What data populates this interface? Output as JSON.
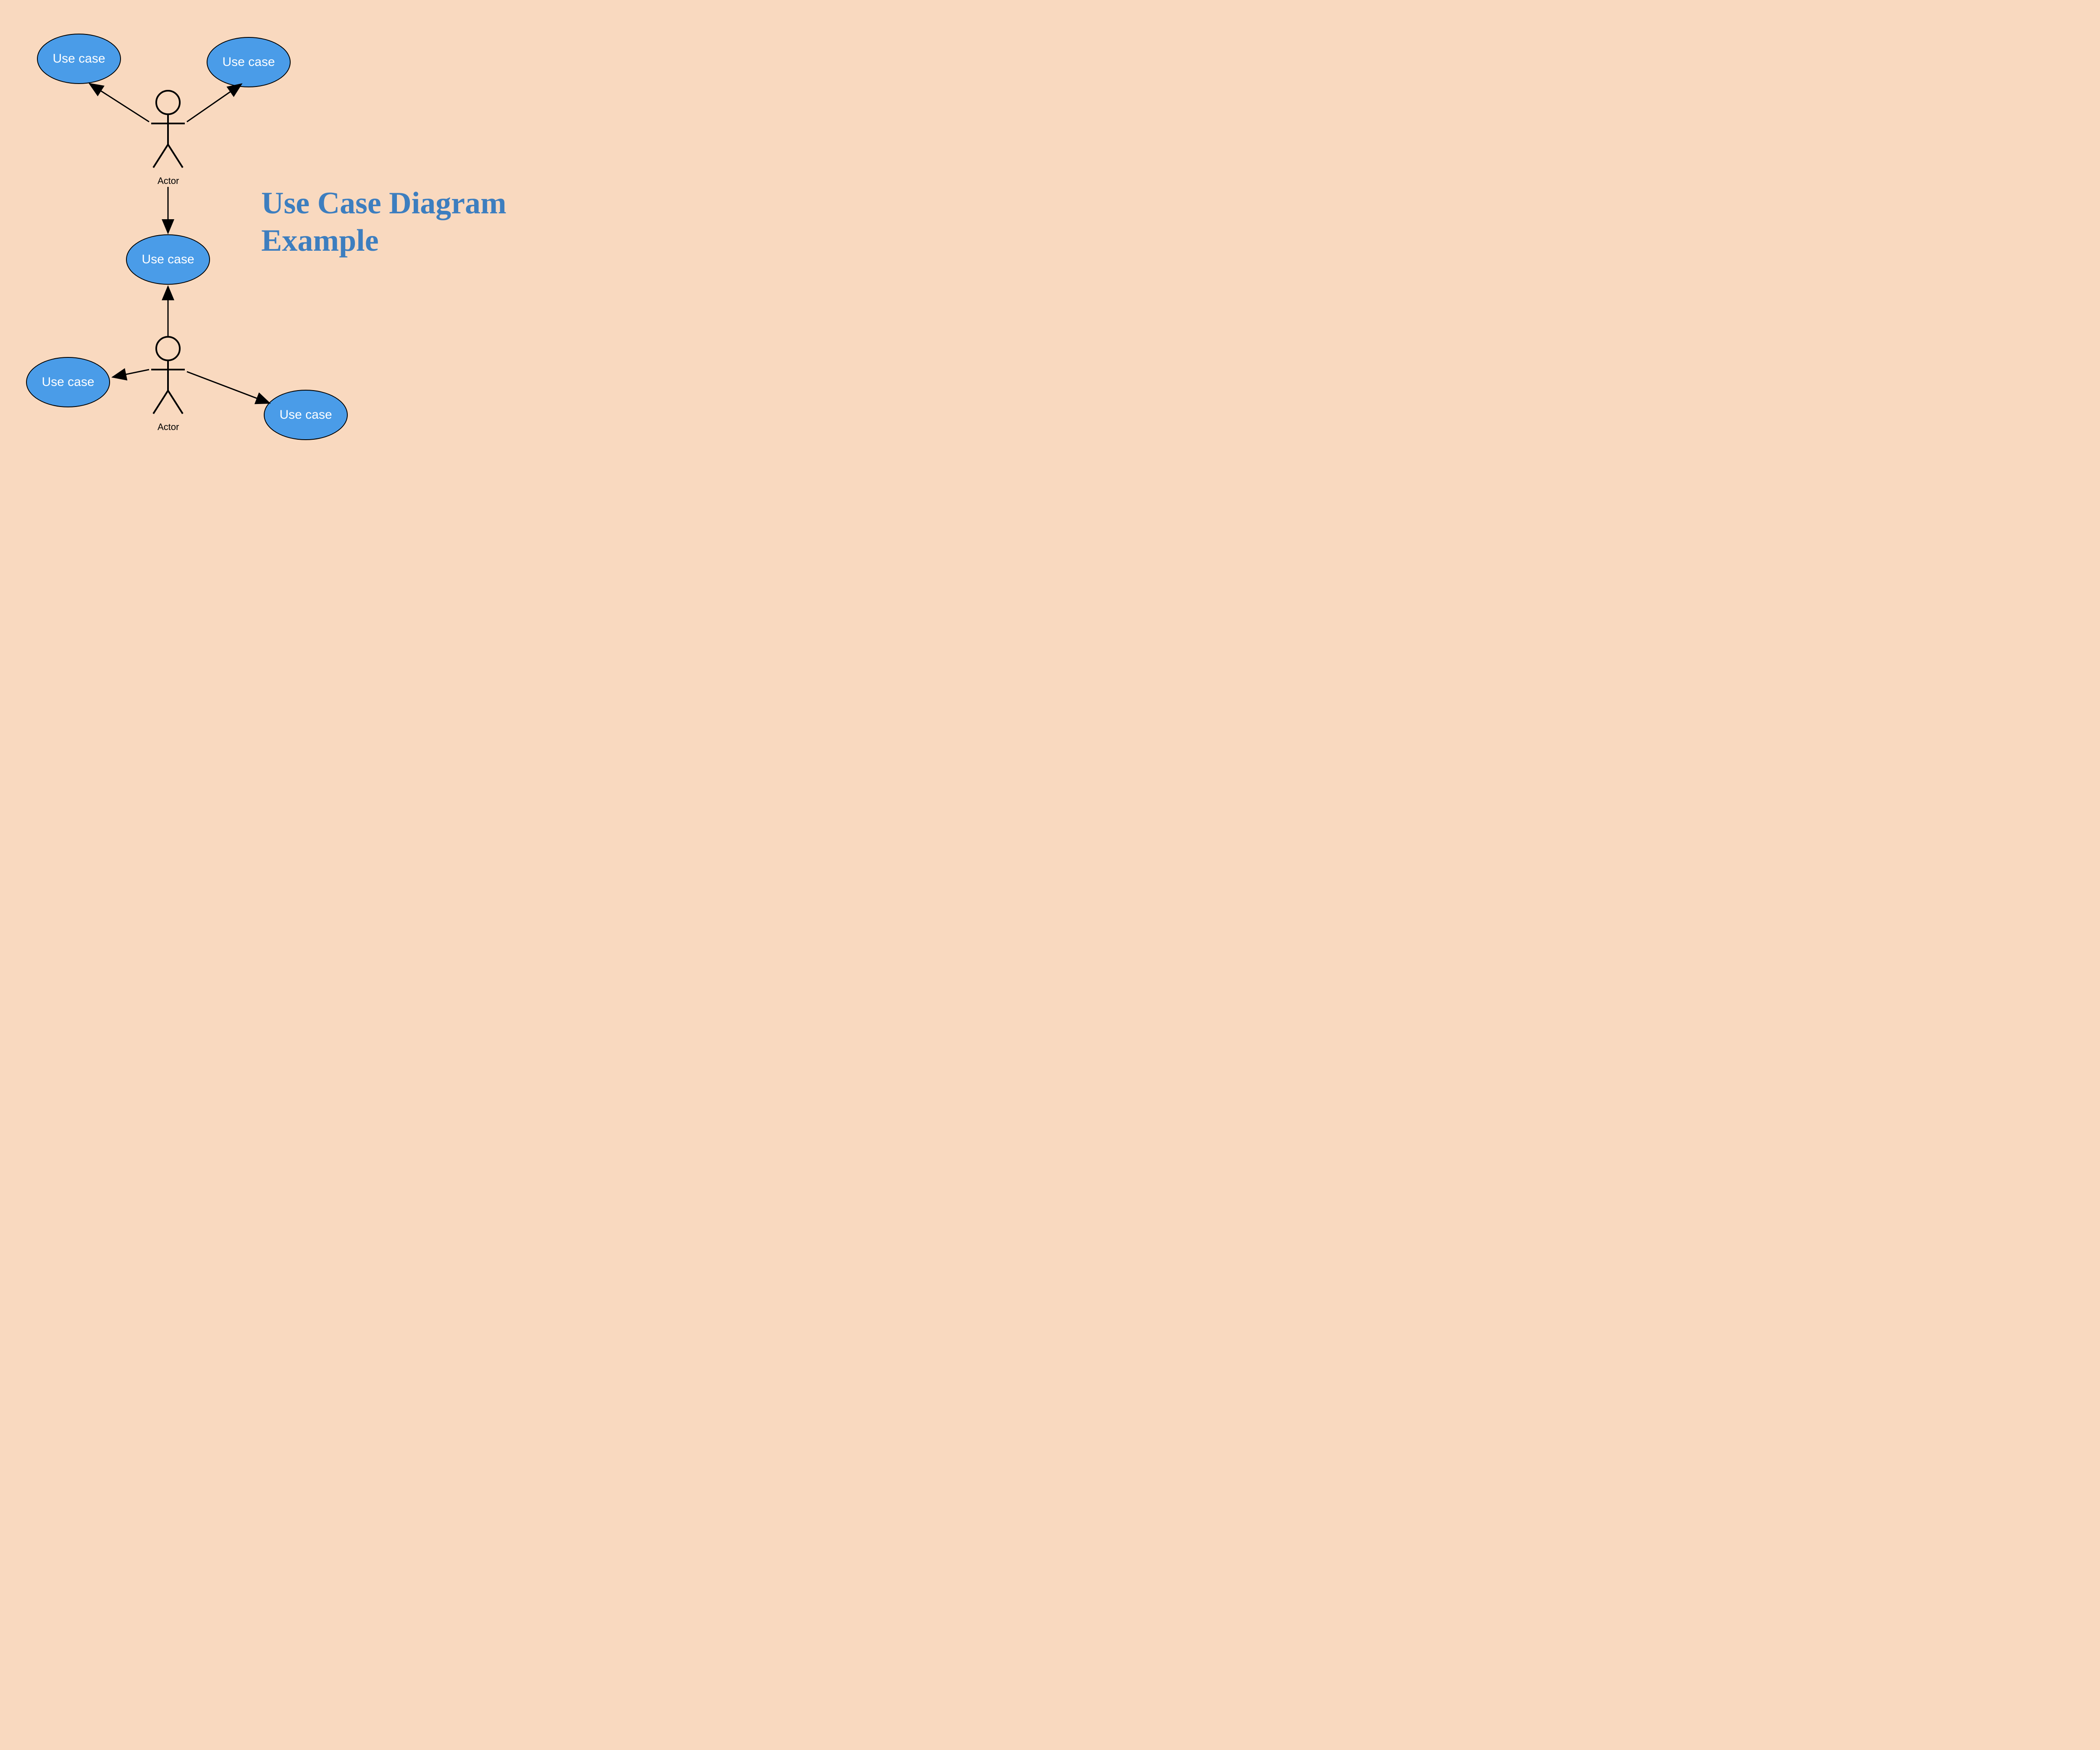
{
  "title_line1": "Use Case Diagram",
  "title_line2": "Example",
  "usecases": {
    "uc1": "Use case",
    "uc2": "Use case",
    "uc3": "Use case",
    "uc4": "Use case",
    "uc5": "Use case"
  },
  "actors": {
    "actor1": "Actor",
    "actor2": "Actor"
  },
  "colors": {
    "background": "#f9d9bf",
    "usecase_fill": "#4a9ce8",
    "title": "#3d7ebf"
  }
}
